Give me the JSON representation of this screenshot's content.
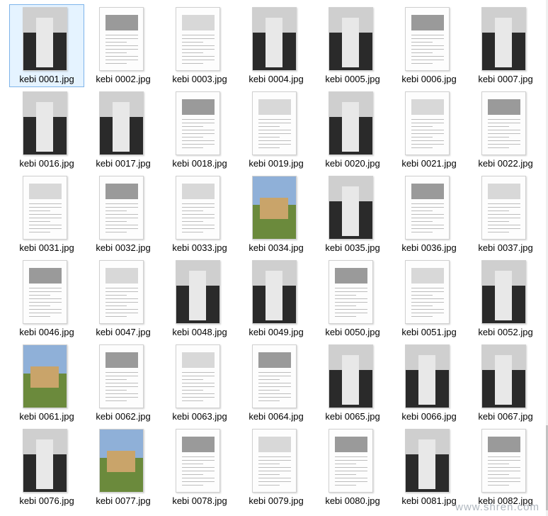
{
  "files": [
    {
      "name": "kebi 0001.jpg",
      "kind": "photo",
      "selected": true
    },
    {
      "name": "kebi 0002.jpg",
      "kind": "text"
    },
    {
      "name": "kebi 0003.jpg",
      "kind": "text"
    },
    {
      "name": "kebi 0004.jpg",
      "kind": "photo"
    },
    {
      "name": "kebi 0005.jpg",
      "kind": "photo"
    },
    {
      "name": "kebi 0006.jpg",
      "kind": "text"
    },
    {
      "name": "kebi 0007.jpg",
      "kind": "photo"
    },
    {
      "name": "kebi 0016.jpg",
      "kind": "photo"
    },
    {
      "name": "kebi 0017.jpg",
      "kind": "photo"
    },
    {
      "name": "kebi 0018.jpg",
      "kind": "text"
    },
    {
      "name": "kebi 0019.jpg",
      "kind": "text"
    },
    {
      "name": "kebi 0020.jpg",
      "kind": "photo"
    },
    {
      "name": "kebi 0021.jpg",
      "kind": "text"
    },
    {
      "name": "kebi 0022.jpg",
      "kind": "text"
    },
    {
      "name": "kebi 0031.jpg",
      "kind": "text"
    },
    {
      "name": "kebi 0032.jpg",
      "kind": "text"
    },
    {
      "name": "kebi 0033.jpg",
      "kind": "text"
    },
    {
      "name": "kebi 0034.jpg",
      "kind": "color"
    },
    {
      "name": "kebi 0035.jpg",
      "kind": "photo"
    },
    {
      "name": "kebi 0036.jpg",
      "kind": "text"
    },
    {
      "name": "kebi 0037.jpg",
      "kind": "text"
    },
    {
      "name": "kebi 0046.jpg",
      "kind": "text"
    },
    {
      "name": "kebi 0047.jpg",
      "kind": "text"
    },
    {
      "name": "kebi 0048.jpg",
      "kind": "photo"
    },
    {
      "name": "kebi 0049.jpg",
      "kind": "photo"
    },
    {
      "name": "kebi 0050.jpg",
      "kind": "text"
    },
    {
      "name": "kebi 0051.jpg",
      "kind": "text"
    },
    {
      "name": "kebi 0052.jpg",
      "kind": "photo"
    },
    {
      "name": "kebi 0061.jpg",
      "kind": "color"
    },
    {
      "name": "kebi 0062.jpg",
      "kind": "text"
    },
    {
      "name": "kebi 0063.jpg",
      "kind": "text"
    },
    {
      "name": "kebi 0064.jpg",
      "kind": "text"
    },
    {
      "name": "kebi 0065.jpg",
      "kind": "photo"
    },
    {
      "name": "kebi 0066.jpg",
      "kind": "photo"
    },
    {
      "name": "kebi 0067.jpg",
      "kind": "photo"
    },
    {
      "name": "kebi 0076.jpg",
      "kind": "photo"
    },
    {
      "name": "kebi 0077.jpg",
      "kind": "color"
    },
    {
      "name": "kebi 0078.jpg",
      "kind": "text"
    },
    {
      "name": "kebi 0079.jpg",
      "kind": "text"
    },
    {
      "name": "kebi 0080.jpg",
      "kind": "text"
    },
    {
      "name": "kebi 0081.jpg",
      "kind": "photo"
    },
    {
      "name": "kebi 0082.jpg",
      "kind": "text"
    }
  ],
  "watermark": "www.shren.com",
  "colors": {
    "selection_border": "#7eb4ea",
    "selection_fill": "#e5f3ff"
  }
}
